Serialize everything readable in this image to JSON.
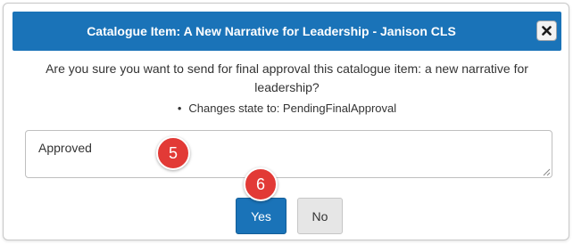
{
  "dialog": {
    "title": "Catalogue Item: A New Narrative for Leadership - Janison CLS",
    "close_icon": "close-icon",
    "message_line1": "Are you sure you want to send for final approval this catalogue item: a new narrative for",
    "message_line2": "leadership?",
    "state_change": "Changes state to: PendingFinalApproval",
    "comment_value": "Approved",
    "yes_label": "Yes",
    "no_label": "No",
    "colors": {
      "header": "#1a73b8",
      "badge": "#e23a36",
      "primary_button": "#1a73b8"
    }
  },
  "annotations": {
    "step5": "5",
    "step6": "6"
  }
}
